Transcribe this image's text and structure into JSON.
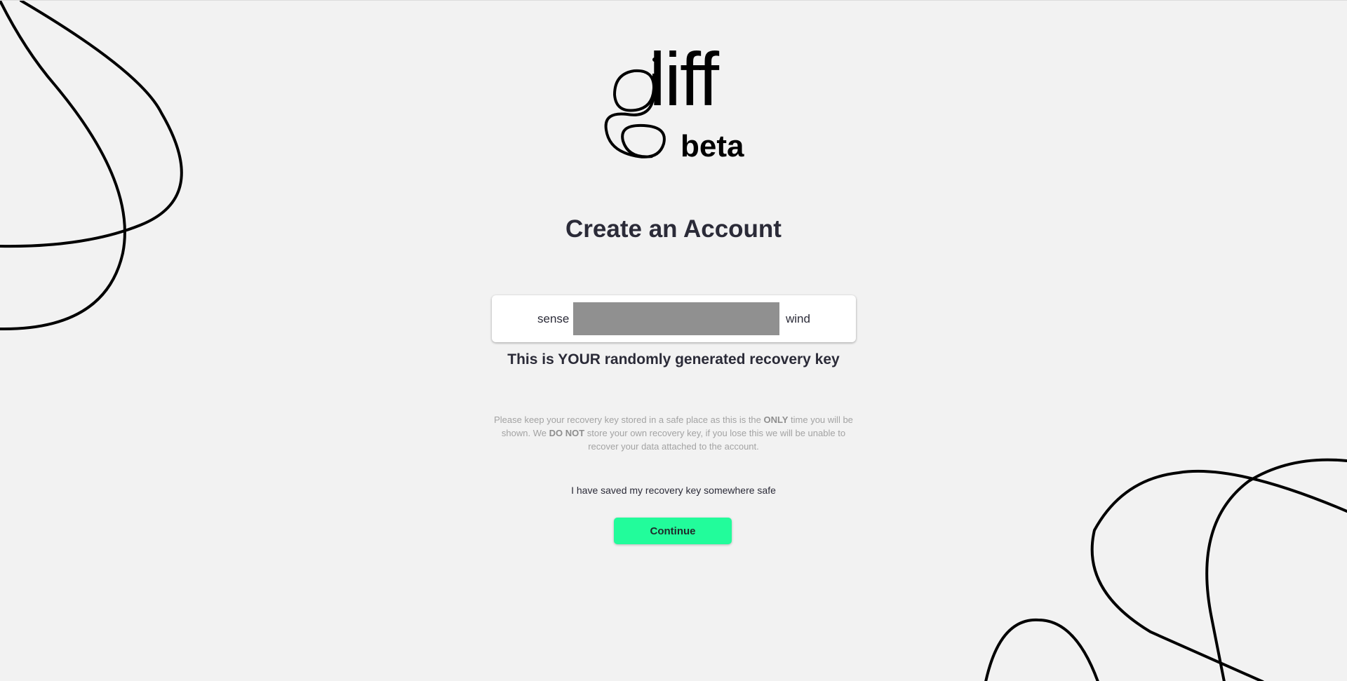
{
  "branding": {
    "logo_text": "gliff",
    "wordmark": "liff",
    "tag": "beta"
  },
  "title": "Create an Account",
  "recovery_key": {
    "first_word": "sense",
    "last_word": "wind",
    "caption": "This is YOUR randomly generated recovery key"
  },
  "notice": {
    "part1": "Please keep your recovery key stored in a safe place as this is the ",
    "emph1": "ONLY",
    "part2": " time you will be shown. We ",
    "emph2": "DO NOT",
    "part3": " store your own recovery key, if you lose this we will be unable to recover your data attached to the account."
  },
  "confirm_label": "I have saved my recovery key somewhere safe",
  "continue_label": "Continue",
  "colors": {
    "accent": "#22fc9b",
    "background": "#f2f2f2",
    "text": "#2b2b38"
  }
}
